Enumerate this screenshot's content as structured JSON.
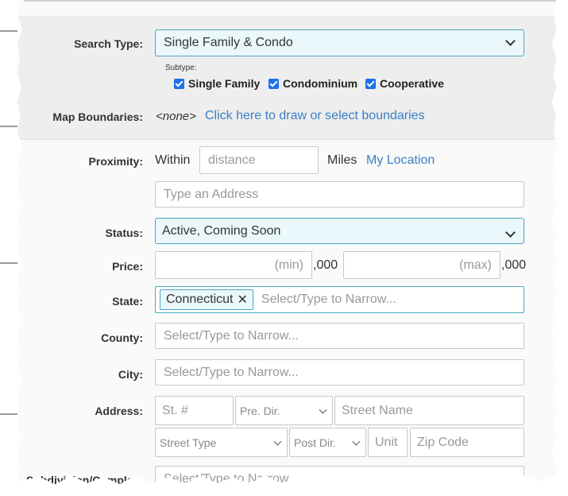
{
  "search_type": {
    "label": "Search Type:",
    "value": "Single Family & Condo",
    "subtype_label": "Subtype:",
    "subtypes": [
      {
        "label": "Single Family",
        "checked": true
      },
      {
        "label": "Condominium",
        "checked": true
      },
      {
        "label": "Cooperative",
        "checked": true
      }
    ]
  },
  "map_boundaries": {
    "label": "Map Boundaries:",
    "value": "<none>",
    "link": "Click here to draw or select boundaries"
  },
  "proximity": {
    "label": "Proximity:",
    "within": "Within",
    "distance_placeholder": "distance",
    "miles": "Miles",
    "my_location": "My Location",
    "address_placeholder": "Type an Address"
  },
  "status": {
    "label": "Status:",
    "value": "Active, Coming Soon"
  },
  "price": {
    "label": "Price:",
    "min_placeholder": "(min)",
    "max_placeholder": "(max)",
    "suffix": ",000"
  },
  "state": {
    "label": "State:",
    "tag": "Connecticut",
    "placeholder": "Select/Type to Narrow..."
  },
  "county": {
    "label": "County:",
    "placeholder": "Select/Type to Narrow..."
  },
  "city": {
    "label": "City:",
    "placeholder": "Select/Type to Narrow..."
  },
  "address": {
    "label": "Address:",
    "street_number_placeholder": "St. #",
    "pre_dir_placeholder": "Pre. Dir.",
    "street_name_placeholder": "Street Name",
    "street_type_placeholder": "Street Type",
    "post_dir_placeholder": "Post Dir.",
    "unit_placeholder": "Unit",
    "zip_placeholder": "Zip Code"
  },
  "subdivision": {
    "label": "Subdivision/Complex:",
    "placeholder": "Select/Type to Narrow..."
  },
  "colors": {
    "accent_border": "#4aa6c2",
    "select_bg": "#eaf7fb",
    "link": "#3a7fc4",
    "checkbox": "#1a73e8"
  }
}
